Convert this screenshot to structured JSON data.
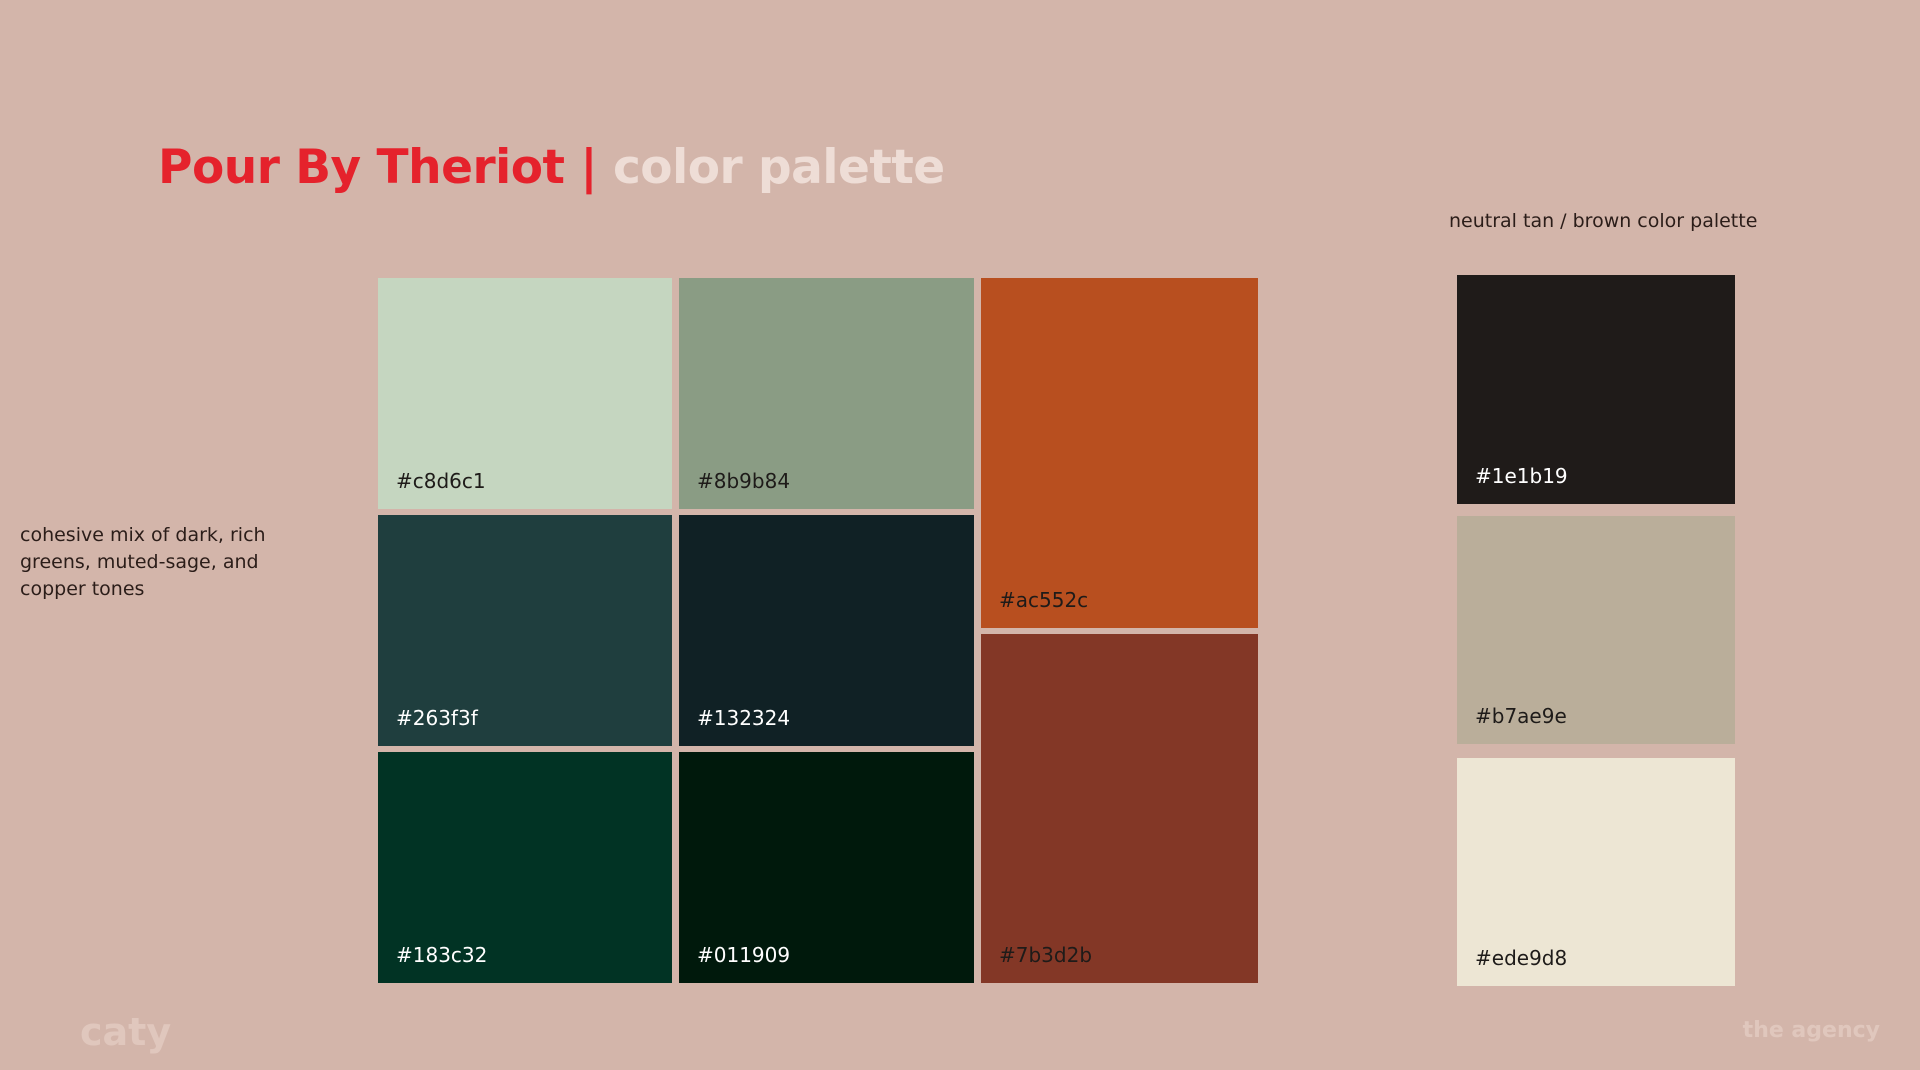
{
  "title": {
    "brand": "Pour By Theriot",
    "separator": "|",
    "subtitle": "color palette"
  },
  "description": "cohesive mix of dark, rich greens, muted-sage, and copper tones",
  "neutral_label": "neutral tan / brown color palette",
  "main_palette": [
    {
      "hex": "#c8d6c1",
      "color": "#c5d6c0",
      "text_color": "dark"
    },
    {
      "hex": "#8b9b84",
      "color": "#8a9c84",
      "text_color": "dark"
    },
    {
      "hex": "#ac552c",
      "color": "#b84f1f",
      "text_color": "dark"
    },
    {
      "hex": "#263f3f",
      "color": "#1f3e3e",
      "text_color": "light"
    },
    {
      "hex": "#132324",
      "color": "#102125",
      "text_color": "light"
    },
    {
      "hex": "#183c32",
      "color": "#013324",
      "text_color": "light"
    },
    {
      "hex": "#011909",
      "color": "#00190c",
      "text_color": "light"
    },
    {
      "hex": "#7b3d2b",
      "color": "#833726",
      "text_color": "dark"
    }
  ],
  "neutral_palette": [
    {
      "hex": "#1e1b19",
      "color": "#1f1b19",
      "text_color": "light"
    },
    {
      "hex": "#b7ae9e",
      "color": "#baae9a",
      "text_color": "dark"
    },
    {
      "hex": "#ede9d8",
      "color": "#ede6d4",
      "text_color": "dark"
    }
  ],
  "footer": {
    "left": "caty",
    "right": "the agency"
  }
}
